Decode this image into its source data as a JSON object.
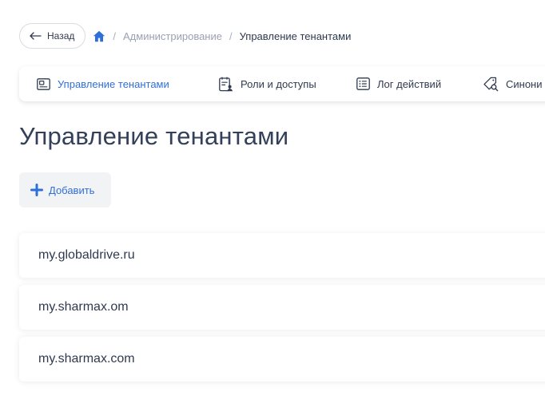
{
  "header": {
    "back_label": "Назад",
    "breadcrumb": {
      "home_icon": "home-icon",
      "separator": "/",
      "items": [
        {
          "label": "Администрирование"
        },
        {
          "label": "Управление тенантами"
        }
      ]
    }
  },
  "tabs": [
    {
      "label": "Управление тенантами",
      "icon": "tenant-card-icon",
      "active": true
    },
    {
      "label": "Роли и доступы",
      "icon": "roles-document-icon",
      "active": false
    },
    {
      "label": "Лог действий",
      "icon": "log-list-icon",
      "active": false
    },
    {
      "label": "Синони",
      "icon": "synonyms-tag-search-icon",
      "active": false
    }
  ],
  "page": {
    "title": "Управление тенантами",
    "add_label": "Добавить"
  },
  "tenants": [
    {
      "domain": "my.globaldrive.ru"
    },
    {
      "domain": "my.sharmax.om"
    },
    {
      "domain": "my.sharmax.com"
    }
  ],
  "colors": {
    "accent": "#2f6fd9",
    "text": "#2f3a4f",
    "muted": "#9aa2b0",
    "button_bg": "#f2f3f5"
  }
}
